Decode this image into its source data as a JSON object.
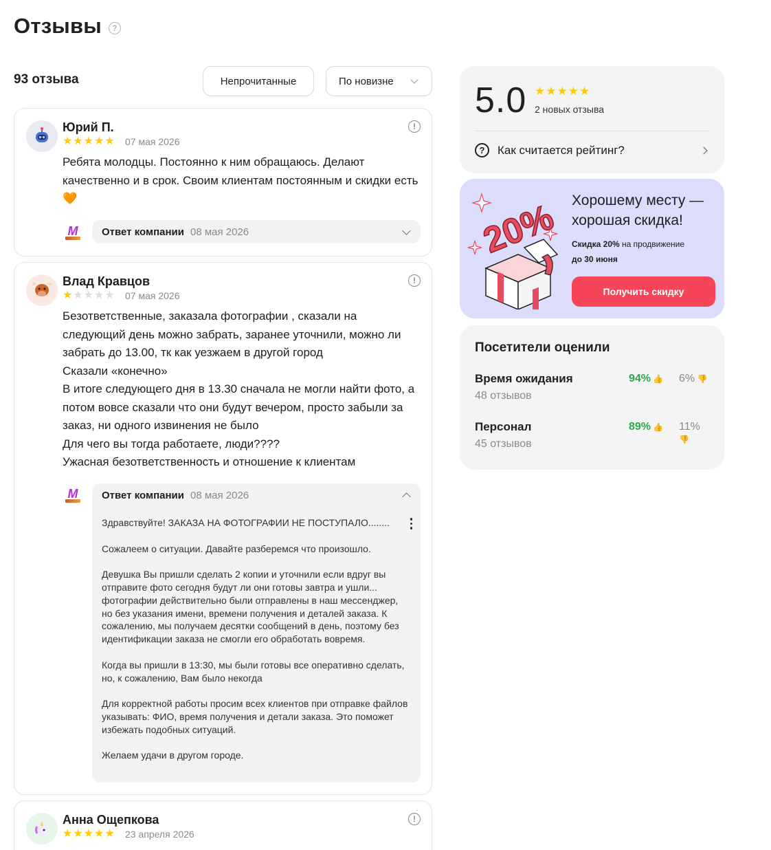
{
  "page": {
    "title": "Отзывы"
  },
  "toolbar": {
    "count": "93 отзыва",
    "unread_label": "Непрочитанные",
    "sort_label": "По новизне"
  },
  "reviews": [
    {
      "author": "Юрий П.",
      "rating": 5,
      "date": "07 мая 2026",
      "avatar_icon": "robot-icon",
      "text": "Ребята молодцы. Постоянно к ним обращаюсь. Делают качественно и в срок. Своим клиентам постоянным и скидки есть 🧡",
      "answer": {
        "label": "Ответ компании",
        "date": "08 мая 2026",
        "expanded": false
      }
    },
    {
      "author": "Влад Кравцов",
      "rating": 1,
      "date": "07 мая 2026",
      "avatar_icon": "bull-icon",
      "text": "Безответственные, заказала фотографии , сказали на следующий день можно забрать, заранее уточнили, можно ли забрать до 13.00, тк как уезжаем в другой город\nСказали «конечно»\nВ итоге следующего дня в 13.30 сначала не могли найти фото, а потом вовсе сказали что они будут вечером, просто забыли за заказ, ни одного извинения не было\nДля чего вы тогда работаете, люди????\nУжасная безответственность и отношение к клиентам",
      "answer": {
        "label": "Ответ компании",
        "date": "08 мая 2026",
        "expanded": true,
        "paragraphs": [
          "Здравствуйте! ЗАКАЗА НА ФОТОГРАФИИ НЕ ПОСТУПАЛО........",
          "Сожалеем о ситуации. Давайте разберемся что произошло.",
          "Девушка Вы пришли сделать 2 копии и уточнили если вдруг вы отправите фото сегодня будут ли они готовы завтра и ушли... фотографии действительно были отправлены в наш мессенджер, но без указания имени, времени получения и деталей заказа. К сожалению, мы получаем десятки сообщений в день, поэтому без идентификации заказа не смогли его обработать вовремя.",
          "Когда вы пришли в 13:30, мы были готовы все оперативно сделать, но, к сожалению, Вам было некогда",
          "Для корректной работы просим всех клиентов при отправке файлов указывать: ФИО, время получения и детали заказа. Это поможет избежать подобных ситуаций.",
          "Желаем удачи в другом городе."
        ]
      }
    },
    {
      "author": "Анна Ощепкова",
      "rating": 5,
      "date": "23 апреля 2026",
      "avatar_icon": "unicorn-icon"
    }
  ],
  "rating_card": {
    "value": "5.0",
    "subtitle": "2 новых отзыва",
    "how_label": "Как считается рейтинг?"
  },
  "promo": {
    "title": "Хорошему месту — хорошая скидка!",
    "discount_strong": "Скидка 20%",
    "discount_rest": " на продвижение",
    "until": "до 30 июня",
    "button": "Получить скидку",
    "art_text": "20%"
  },
  "visitors": {
    "title": "Посетители оценили",
    "rows": [
      {
        "name": "Время ожидания",
        "count": "48 отзывов",
        "positive": "94%",
        "negative": "6%"
      },
      {
        "name": "Персонал",
        "count": "45 отзывов",
        "positive": "89%",
        "negative": "11%"
      }
    ]
  },
  "colors": {
    "accent": "#f64559",
    "star": "#ffcc00",
    "positive": "#2ea84c",
    "promo_bg": "#dcdcfb"
  }
}
